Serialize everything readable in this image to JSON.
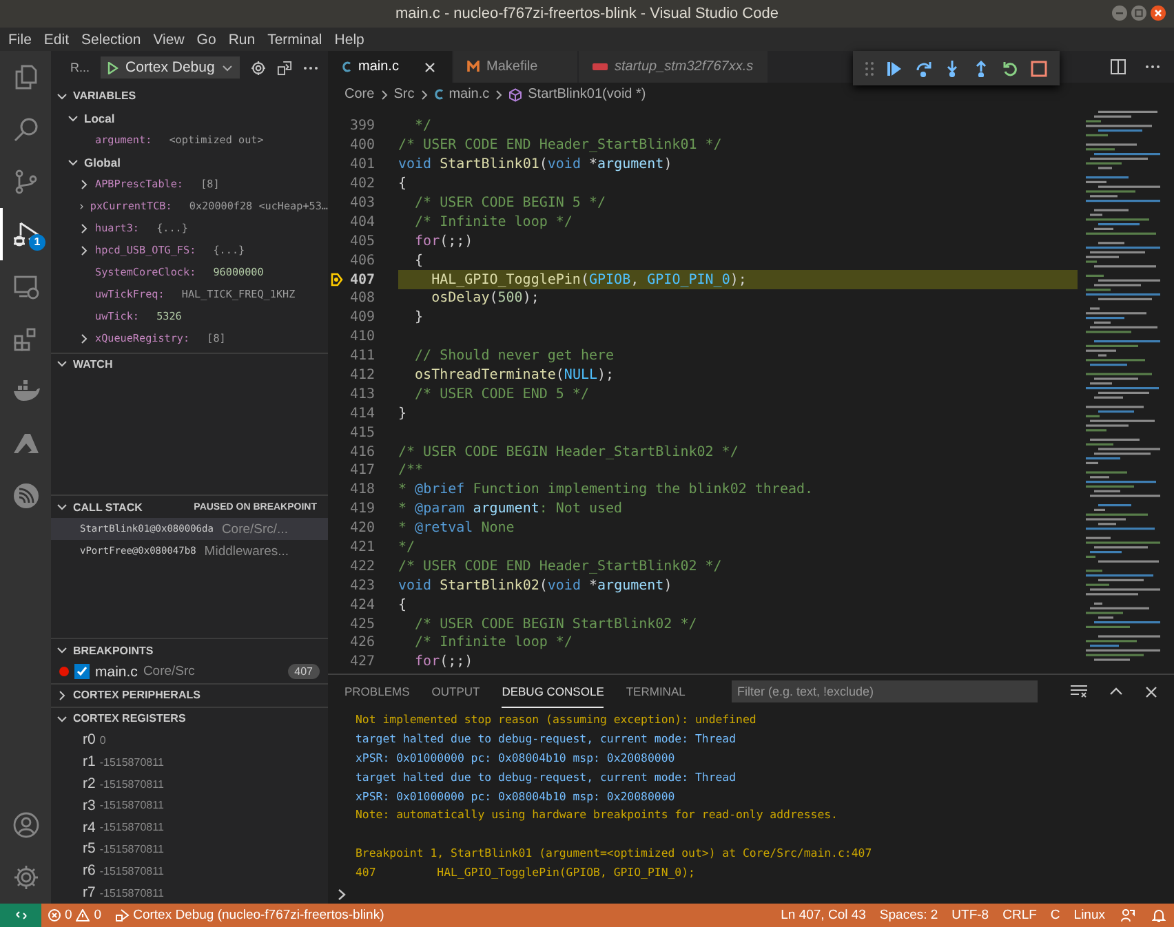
{
  "window": {
    "title": "main.c - nucleo-f767zi-freertos-blink - Visual Studio Code"
  },
  "menu": [
    "File",
    "Edit",
    "Selection",
    "View",
    "Go",
    "Run",
    "Terminal",
    "Help"
  ],
  "activity_bar": {
    "debug_badge": "1"
  },
  "run_header": {
    "label": "R...",
    "configuration": "Cortex Debug"
  },
  "variables": {
    "title": "VARIABLES",
    "expanded": true,
    "scopes": [
      {
        "name": "Local",
        "expanded": true,
        "children": [
          {
            "name": "argument:",
            "value": "<optimized out>",
            "expandable": false
          }
        ]
      },
      {
        "name": "Global",
        "expanded": true,
        "children": [
          {
            "name": "APBPrescTable:",
            "value": "[8]",
            "expandable": true
          },
          {
            "name": "pxCurrentTCB:",
            "value": "0x20000f28 <ucHeap+53…",
            "expandable": true
          },
          {
            "name": "huart3:",
            "value": "{...}",
            "expandable": true
          },
          {
            "name": "hpcd_USB_OTG_FS:",
            "value": "{...}",
            "expandable": true
          },
          {
            "name": "SystemCoreClock:",
            "value": "96000000",
            "expandable": false
          },
          {
            "name": "uwTickFreq:",
            "value": "HAL_TICK_FREQ_1KHZ",
            "expandable": false
          },
          {
            "name": "uwTick:",
            "value": "5326",
            "expandable": false
          },
          {
            "name": "xQueueRegistry:",
            "value": "[8]",
            "expandable": true
          }
        ]
      }
    ]
  },
  "watch": {
    "title": "WATCH",
    "expanded": true
  },
  "call_stack": {
    "title": "CALL STACK",
    "expanded": true,
    "status": "PAUSED ON BREAKPOINT",
    "frames": [
      {
        "name": "StartBlink01@0x080006da",
        "source": "Core/Src/...",
        "selected": true
      },
      {
        "name": "vPortFree@0x080047b8",
        "source": "Middlewares...",
        "selected": false
      }
    ]
  },
  "breakpoints": {
    "title": "BREAKPOINTS",
    "expanded": true,
    "items": [
      {
        "file": "main.c",
        "path": "Core/Src",
        "line": "407",
        "checked": true
      }
    ]
  },
  "cortex_peripherals": {
    "title": "CORTEX PERIPHERALS",
    "expanded": false
  },
  "cortex_registers": {
    "title": "CORTEX REGISTERS",
    "expanded": true,
    "registers": [
      {
        "name": "r0",
        "value": "0"
      },
      {
        "name": "r1",
        "value": "-1515870811"
      },
      {
        "name": "r2",
        "value": "-1515870811"
      },
      {
        "name": "r3",
        "value": "-1515870811"
      },
      {
        "name": "r4",
        "value": "-1515870811"
      },
      {
        "name": "r5",
        "value": "-1515870811"
      },
      {
        "name": "r6",
        "value": "-1515870811"
      },
      {
        "name": "r7",
        "value": "-1515870811"
      }
    ]
  },
  "tabs": [
    {
      "label": "main.c",
      "kind": "c",
      "selected": true,
      "preview": false
    },
    {
      "label": "Makefile",
      "kind": "make",
      "selected": false,
      "preview": false
    },
    {
      "label": "startup_stm32f767xx.s",
      "kind": "asm",
      "selected": false,
      "preview": true
    }
  ],
  "breadcrumb": [
    {
      "label": "Core",
      "kind": "folder"
    },
    {
      "label": "Src",
      "kind": "folder"
    },
    {
      "label": "main.c",
      "kind": "c"
    },
    {
      "label": "StartBlink01(void *)",
      "kind": "function"
    }
  ],
  "code": [
    {
      "number": "399",
      "current": false,
      "breakpoint": false,
      "tokens": [
        {
          "text": "  */",
          "kind": "comment"
        }
      ]
    },
    {
      "number": "400",
      "current": false,
      "breakpoint": false,
      "tokens": [
        {
          "text": "/* USER CODE END Header_StartBlink01 */",
          "kind": "comment"
        }
      ]
    },
    {
      "number": "401",
      "current": false,
      "breakpoint": false,
      "tokens": [
        {
          "text": "void ",
          "kind": "keyword"
        },
        {
          "text": "StartBlink01",
          "kind": "func"
        },
        {
          "text": "(",
          "kind": "plain"
        },
        {
          "text": "void ",
          "kind": "keyword"
        },
        {
          "text": "*",
          "kind": "plain"
        },
        {
          "text": "argument",
          "kind": "param"
        },
        {
          "text": ")",
          "kind": "plain"
        }
      ]
    },
    {
      "number": "402",
      "current": false,
      "breakpoint": false,
      "tokens": [
        {
          "text": "{",
          "kind": "plain"
        }
      ]
    },
    {
      "number": "403",
      "current": false,
      "breakpoint": false,
      "tokens": [
        {
          "text": "  /* USER CODE BEGIN 5 */",
          "kind": "comment"
        }
      ]
    },
    {
      "number": "404",
      "current": false,
      "breakpoint": false,
      "tokens": [
        {
          "text": "  /* Infinite loop */",
          "kind": "comment"
        }
      ]
    },
    {
      "number": "405",
      "current": false,
      "breakpoint": false,
      "tokens": [
        {
          "text": "  for",
          "kind": "control"
        },
        {
          "text": "(;;)",
          "kind": "plain"
        }
      ]
    },
    {
      "number": "406",
      "current": false,
      "breakpoint": false,
      "tokens": [
        {
          "text": "  {",
          "kind": "plain"
        }
      ]
    },
    {
      "number": "407",
      "current": true,
      "breakpoint": true,
      "tokens": [
        {
          "text": "    HAL_GPIO_TogglePin",
          "kind": "func"
        },
        {
          "text": "(",
          "kind": "plain"
        },
        {
          "text": "GPIOB",
          "kind": "const"
        },
        {
          "text": ", ",
          "kind": "plain"
        },
        {
          "text": "GPIO_PIN_0",
          "kind": "const"
        },
        {
          "text": ");",
          "kind": "plain"
        }
      ]
    },
    {
      "number": "408",
      "current": false,
      "breakpoint": false,
      "tokens": [
        {
          "text": "    osDelay",
          "kind": "func"
        },
        {
          "text": "(",
          "kind": "plain"
        },
        {
          "text": "500",
          "kind": "number"
        },
        {
          "text": ");",
          "kind": "plain"
        }
      ]
    },
    {
      "number": "409",
      "current": false,
      "breakpoint": false,
      "tokens": [
        {
          "text": "  }",
          "kind": "plain"
        }
      ]
    },
    {
      "number": "410",
      "current": false,
      "breakpoint": false
    },
    {
      "number": "411",
      "current": false,
      "breakpoint": false,
      "tokens": [
        {
          "text": "  // Should never get here",
          "kind": "comment"
        }
      ]
    },
    {
      "number": "412",
      "current": false,
      "breakpoint": false,
      "tokens": [
        {
          "text": "  osThreadTerminate",
          "kind": "func"
        },
        {
          "text": "(",
          "kind": "plain"
        },
        {
          "text": "NULL",
          "kind": "const"
        },
        {
          "text": ");",
          "kind": "plain"
        }
      ]
    },
    {
      "number": "413",
      "current": false,
      "breakpoint": false,
      "tokens": [
        {
          "text": "  /* USER CODE END 5 */",
          "kind": "comment"
        }
      ]
    },
    {
      "number": "414",
      "current": false,
      "breakpoint": false,
      "tokens": [
        {
          "text": "}",
          "kind": "plain"
        }
      ]
    },
    {
      "number": "415",
      "current": false,
      "breakpoint": false
    },
    {
      "number": "416",
      "current": false,
      "breakpoint": false,
      "tokens": [
        {
          "text": "/* USER CODE BEGIN Header_StartBlink02 */",
          "kind": "comment"
        }
      ]
    },
    {
      "number": "417",
      "current": false,
      "breakpoint": false,
      "tokens": [
        {
          "text": "/**",
          "kind": "comment"
        }
      ]
    },
    {
      "number": "418",
      "current": false,
      "breakpoint": false,
      "tokens": [
        {
          "text": "* ",
          "kind": "comment"
        },
        {
          "text": "@brief",
          "kind": "keyword"
        },
        {
          "text": " Function implementing the blink02 thread.",
          "kind": "comment"
        }
      ]
    },
    {
      "number": "419",
      "current": false,
      "breakpoint": false,
      "tokens": [
        {
          "text": "* ",
          "kind": "comment"
        },
        {
          "text": "@param ",
          "kind": "keyword"
        },
        {
          "text": "argument",
          "kind": "param"
        },
        {
          "text": ": Not used",
          "kind": "comment"
        }
      ]
    },
    {
      "number": "420",
      "current": false,
      "breakpoint": false,
      "tokens": [
        {
          "text": "* ",
          "kind": "comment"
        },
        {
          "text": "@retval",
          "kind": "keyword"
        },
        {
          "text": " None",
          "kind": "comment"
        }
      ]
    },
    {
      "number": "421",
      "current": false,
      "breakpoint": false,
      "tokens": [
        {
          "text": "*/",
          "kind": "comment"
        }
      ]
    },
    {
      "number": "422",
      "current": false,
      "breakpoint": false,
      "tokens": [
        {
          "text": "/* USER CODE END Header_StartBlink02 */",
          "kind": "comment"
        }
      ]
    },
    {
      "number": "423",
      "current": false,
      "breakpoint": false,
      "tokens": [
        {
          "text": "void ",
          "kind": "keyword"
        },
        {
          "text": "StartBlink02",
          "kind": "func"
        },
        {
          "text": "(",
          "kind": "plain"
        },
        {
          "text": "void ",
          "kind": "keyword"
        },
        {
          "text": "*",
          "kind": "plain"
        },
        {
          "text": "argument",
          "kind": "param"
        },
        {
          "text": ")",
          "kind": "plain"
        }
      ]
    },
    {
      "number": "424",
      "current": false,
      "breakpoint": false,
      "tokens": [
        {
          "text": "{",
          "kind": "plain"
        }
      ]
    },
    {
      "number": "425",
      "current": false,
      "breakpoint": false,
      "tokens": [
        {
          "text": "  /* USER CODE BEGIN StartBlink02 */",
          "kind": "comment"
        }
      ]
    },
    {
      "number": "426",
      "current": false,
      "breakpoint": false,
      "tokens": [
        {
          "text": "  /* Infinite loop */",
          "kind": "comment"
        }
      ]
    },
    {
      "number": "427",
      "current": false,
      "breakpoint": false,
      "tokens": [
        {
          "text": "  for",
          "kind": "control"
        },
        {
          "text": "(;;)",
          "kind": "plain"
        }
      ]
    }
  ],
  "panel": {
    "tabs": [
      {
        "label": "PROBLEMS",
        "selected": false
      },
      {
        "label": "OUTPUT",
        "selected": false
      },
      {
        "label": "DEBUG CONSOLE",
        "selected": true
      },
      {
        "label": "TERMINAL",
        "selected": false
      }
    ],
    "filter": {
      "placeholder": "Filter (e.g. text, !exclude)"
    },
    "console": [
      {
        "kind": "warning",
        "text": "Not implemented stop reason (assuming exception): undefined"
      },
      {
        "kind": "info",
        "text": "target halted due to debug-request, current mode: Thread"
      },
      {
        "kind": "info",
        "text": "xPSR: 0x01000000 pc: 0x08004b10 msp: 0x20080000"
      },
      {
        "kind": "info",
        "text": "target halted due to debug-request, current mode: Thread"
      },
      {
        "kind": "info",
        "text": "xPSR: 0x01000000 pc: 0x08004b10 msp: 0x20080000"
      },
      {
        "kind": "warning",
        "text": "Note: automatically using hardware breakpoints for read-only addresses."
      },
      {
        "kind": "blank"
      },
      {
        "kind": "warning",
        "text": "Breakpoint 1, StartBlink01 (argument=<optimized out>) at Core/Src/main.c:407"
      },
      {
        "kind": "warning",
        "text": "407         HAL_GPIO_TogglePin(GPIOB, GPIO_PIN_0);"
      }
    ]
  },
  "status_bar": {
    "errors": "0",
    "warnings": "0",
    "debug_session": "Cortex Debug (nucleo-f767zi-freertos-blink)",
    "position": "Ln 407, Col 43",
    "indentation": "Spaces: 2",
    "encoding": "UTF-8",
    "line_endings": "CRLF",
    "language": "C",
    "platform": "Linux"
  }
}
